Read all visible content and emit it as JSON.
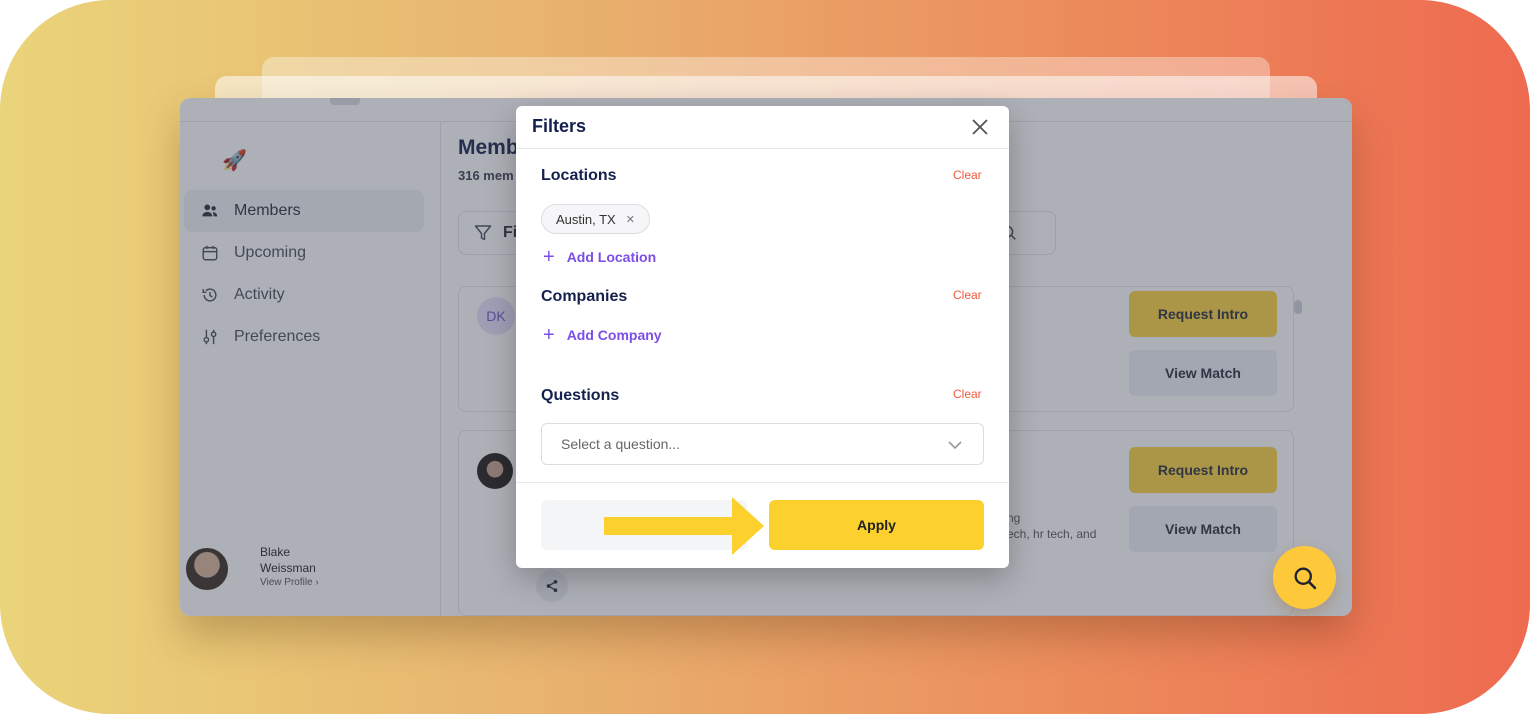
{
  "sidebar": {
    "items": [
      {
        "label": "Members",
        "icon": "users-icon",
        "active": true
      },
      {
        "label": "Upcoming",
        "icon": "calendar-icon",
        "active": false
      },
      {
        "label": "Activity",
        "icon": "history-icon",
        "active": false
      },
      {
        "label": "Preferences",
        "icon": "sliders-icon",
        "active": false
      }
    ],
    "profile": {
      "name": "Blake Weissman",
      "link": "View Profile ›"
    }
  },
  "main": {
    "title": "Memb",
    "subtitle": "316 mem",
    "filter_label": "Fi",
    "cards": [
      {
        "initials": "DK",
        "request_label": "Request Intro",
        "view_label": "View Match"
      },
      {
        "request_label": "Request Intro",
        "view_label": "View Match",
        "snippet_line1": "ng",
        "snippet_line2": "ech, hr tech, and"
      }
    ]
  },
  "filters": {
    "title": "Filters",
    "locations": {
      "title": "Locations",
      "clear": "Clear",
      "chips": [
        "Austin, TX"
      ],
      "add_label": "Add Location"
    },
    "companies": {
      "title": "Companies",
      "clear": "Clear",
      "add_label": "Add Company"
    },
    "questions": {
      "title": "Questions",
      "clear": "Clear",
      "placeholder": "Select a question..."
    },
    "apply_label": "Apply"
  },
  "colors": {
    "accent_yellow": "#fdd12d",
    "clear_red": "#ef5b3d",
    "link_purple": "#7b4ee6",
    "title_navy": "#15214d"
  }
}
